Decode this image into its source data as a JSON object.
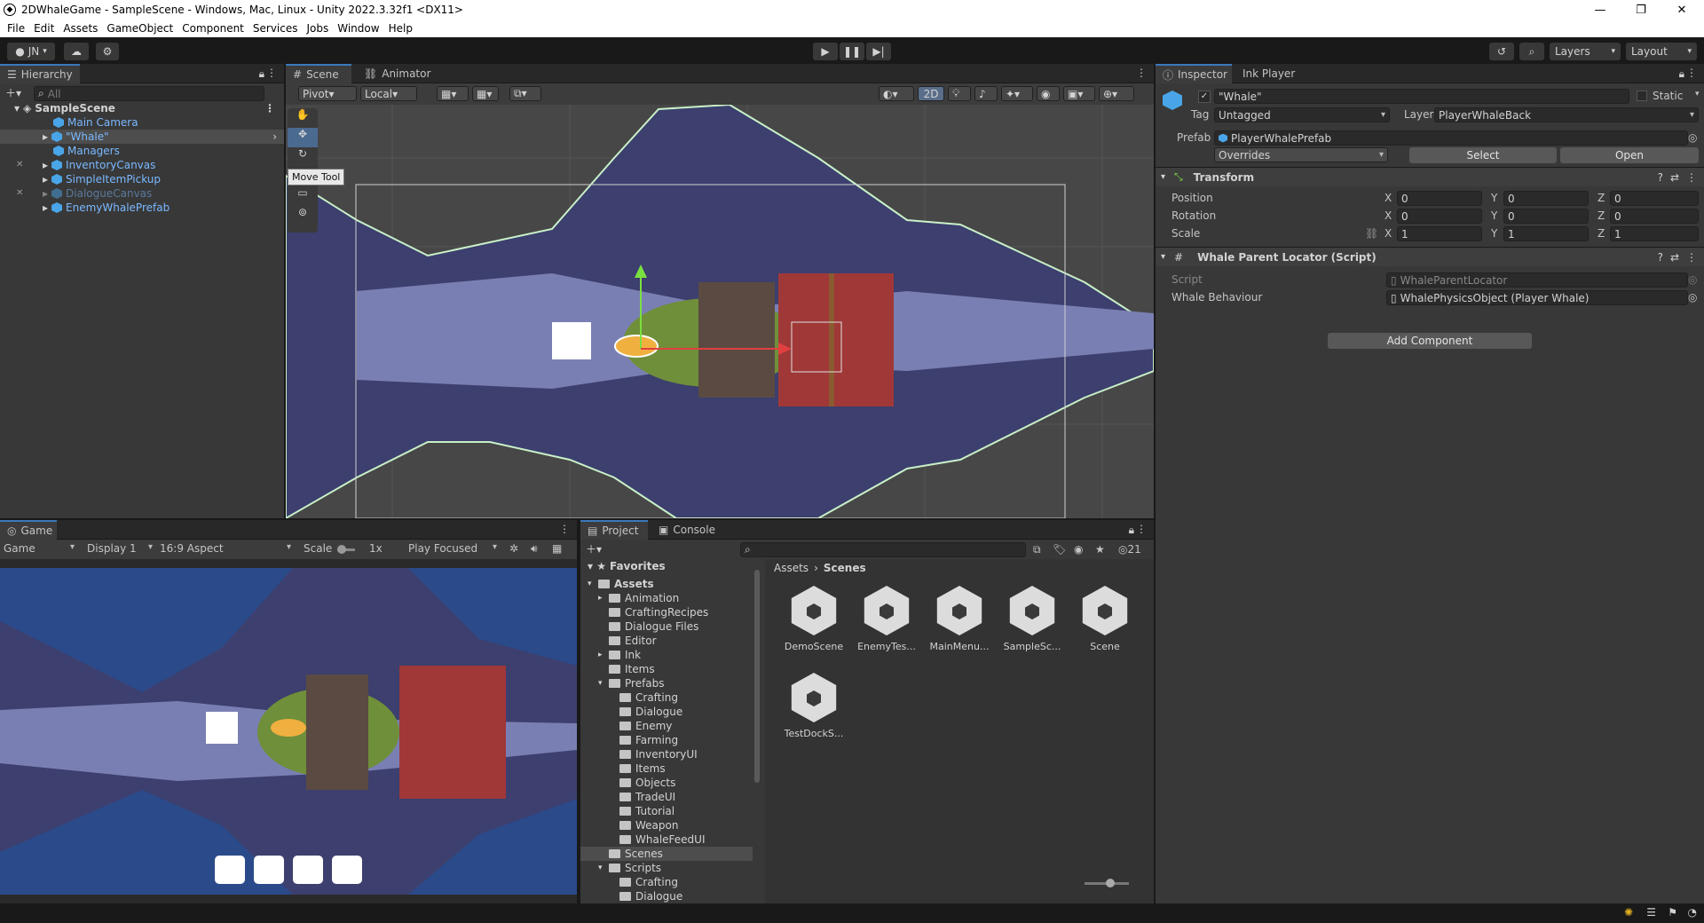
{
  "window": {
    "title": "2DWhaleGame - SampleScene - Windows, Mac, Linux - Unity 2022.3.32f1 <DX11>",
    "minimize": "—",
    "restore": "❐",
    "close": "✕"
  },
  "menu": [
    "File",
    "Edit",
    "Assets",
    "GameObject",
    "Component",
    "Services",
    "Jobs",
    "Window",
    "Help"
  ],
  "toolbar": {
    "account": "JN",
    "layers": "Layers",
    "layout": "Layout"
  },
  "hierarchy": {
    "tab": "Hierarchy",
    "search_placeholder": "All",
    "scene": "SampleScene",
    "items": [
      "Main Camera",
      "\"Whale\"",
      "Managers",
      "InventoryCanvas",
      "SimpleItemPickup",
      "DialogueCanvas",
      "EnemyWhalePrefab"
    ]
  },
  "scene_view": {
    "tabs": [
      "Scene",
      "Animator"
    ],
    "pivot": "Pivot",
    "local": "Local",
    "mode_2d": "2D",
    "tooltip": "Move Tool"
  },
  "game_view": {
    "tab": "Game",
    "game": "Game",
    "display": "Display 1",
    "aspect": "16:9 Aspect",
    "scale_label": "Scale",
    "scale_value": "1x",
    "play_mode": "Play Focused"
  },
  "project": {
    "tabs": [
      "Project",
      "Console"
    ],
    "hidden_count": "21",
    "favorites": "Favorites",
    "tree": [
      {
        "label": "Assets",
        "indent": 0,
        "bold": true
      },
      {
        "label": "Animation",
        "indent": 1
      },
      {
        "label": "CraftingRecipes",
        "indent": 1
      },
      {
        "label": "Dialogue Files",
        "indent": 1
      },
      {
        "label": "Editor",
        "indent": 1
      },
      {
        "label": "Ink",
        "indent": 1
      },
      {
        "label": "Items",
        "indent": 1
      },
      {
        "label": "Prefabs",
        "indent": 1
      },
      {
        "label": "Crafting",
        "indent": 2
      },
      {
        "label": "Dialogue",
        "indent": 2
      },
      {
        "label": "Enemy",
        "indent": 2
      },
      {
        "label": "Farming",
        "indent": 2
      },
      {
        "label": "InventoryUI",
        "indent": 2
      },
      {
        "label": "Items",
        "indent": 2
      },
      {
        "label": "Objects",
        "indent": 2
      },
      {
        "label": "TradeUI",
        "indent": 2
      },
      {
        "label": "Tutorial",
        "indent": 2
      },
      {
        "label": "Weapon",
        "indent": 2
      },
      {
        "label": "WhaleFeedUI",
        "indent": 2
      },
      {
        "label": "Scenes",
        "indent": 1,
        "selected": true
      },
      {
        "label": "Scripts",
        "indent": 1
      },
      {
        "label": "Crafting",
        "indent": 2
      },
      {
        "label": "Dialogue",
        "indent": 2
      }
    ],
    "breadcrumb": [
      "Assets",
      "Scenes"
    ],
    "assets": [
      "DemoScene",
      "EnemyTes...",
      "MainMenu...",
      "SampleSc...",
      "Scene",
      "TestDockS..."
    ]
  },
  "inspector": {
    "tabs": [
      "Inspector",
      "Ink Player"
    ],
    "object_name": "\"Whale\"",
    "static": "Static",
    "tag_label": "Tag",
    "tag": "Untagged",
    "layer_label": "Layer",
    "layer": "PlayerWhaleBack",
    "prefab_label": "Prefab",
    "prefab": "PlayerWhalePrefab",
    "overrides": "Overrides",
    "select": "Select",
    "open": "Open",
    "transform": {
      "title": "Transform",
      "position_label": "Position",
      "rotation_label": "Rotation",
      "scale_label": "Scale",
      "position": [
        "0",
        "0",
        "0"
      ],
      "rotation": [
        "0",
        "0",
        "0"
      ],
      "scale": [
        "1",
        "1",
        "1"
      ],
      "axes": [
        "X",
        "Y",
        "Z"
      ]
    },
    "script_component": {
      "title": "Whale Parent Locator (Script)",
      "script_label": "Script",
      "script": "WhaleParentLocator",
      "behaviour_label": "Whale Behaviour",
      "behaviour": "WhalePhysicsObject (Player Whale)"
    },
    "add_component": "Add Component"
  },
  "colors": {
    "accent": "#3a79bb",
    "panel": "#383838",
    "whale_dark": "#3d3f6e",
    "whale_light": "#7a7fb3",
    "ocean": "#2b4a8a"
  }
}
